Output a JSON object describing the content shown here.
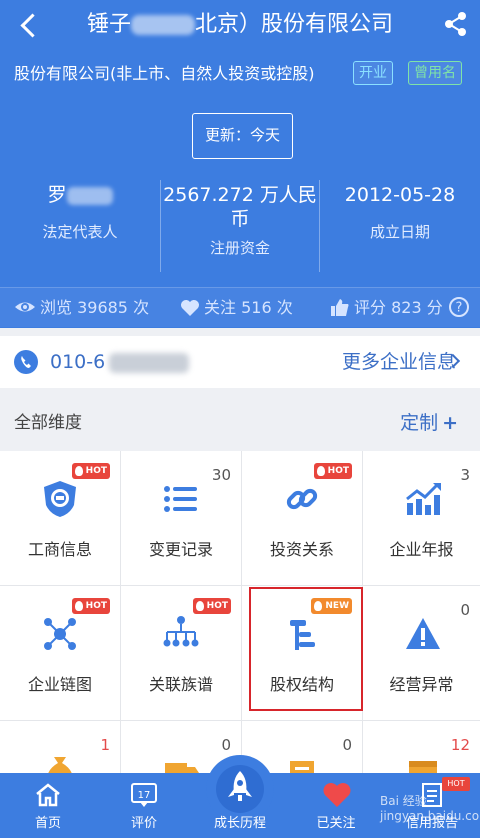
{
  "header": {
    "title_prefix": "锤子",
    "title_suffix": "北京）股份有限公司",
    "company_type": "股份有限公司(非上市、自然人投资或控股)",
    "tags": {
      "open": "开业",
      "alias": "曾用名"
    },
    "update_label": "更新：今天",
    "legal_rep": {
      "value": "罗",
      "label": "法定代表人"
    },
    "capital": {
      "value_line1": "2567.272 万人民",
      "value_line2": "币",
      "label": "注册资金"
    },
    "established": {
      "value": "2012-05-28",
      "label": "成立日期"
    },
    "stats": {
      "views": "浏览 39685 次",
      "follows": "关注 516 次",
      "rating": "评分 823 分"
    }
  },
  "phone": {
    "number_prefix": "010-6",
    "more_label": "更多企业信息"
  },
  "section": {
    "title": "全部维度",
    "customize_label": "定制",
    "customize_plus": "+"
  },
  "grid": {
    "items": [
      {
        "label": "工商信息",
        "badge": "HOT",
        "count": ""
      },
      {
        "label": "变更记录",
        "badge": "",
        "count": "30"
      },
      {
        "label": "投资关系",
        "badge": "HOT",
        "count": ""
      },
      {
        "label": "企业年报",
        "badge": "",
        "count": "3"
      },
      {
        "label": "企业链图",
        "badge": "HOT",
        "count": ""
      },
      {
        "label": "关联族谱",
        "badge": "HOT",
        "count": ""
      },
      {
        "label": "股权结构",
        "badge": "NEW",
        "count": ""
      },
      {
        "label": "经营异常",
        "badge": "",
        "count": "0"
      },
      {
        "label": "",
        "badge": "",
        "count": "1"
      },
      {
        "label": "",
        "badge": "",
        "count": "0"
      },
      {
        "label": "",
        "badge": "",
        "count": "0"
      },
      {
        "label": "",
        "badge": "",
        "count": "12"
      }
    ]
  },
  "nav": {
    "items": [
      {
        "label": "首页"
      },
      {
        "label": "评价",
        "icon_text": "17"
      },
      {
        "label": "成长历程"
      },
      {
        "label": "已关注"
      },
      {
        "label": "信用报告",
        "badge": "HOT"
      }
    ]
  },
  "watermark": "Bai 经验 jingyan.baidu.com",
  "colors": {
    "primary": "#3d7de0",
    "link": "#3c6fc6",
    "hot": "#e8453c",
    "highlight": "#d7252b"
  }
}
